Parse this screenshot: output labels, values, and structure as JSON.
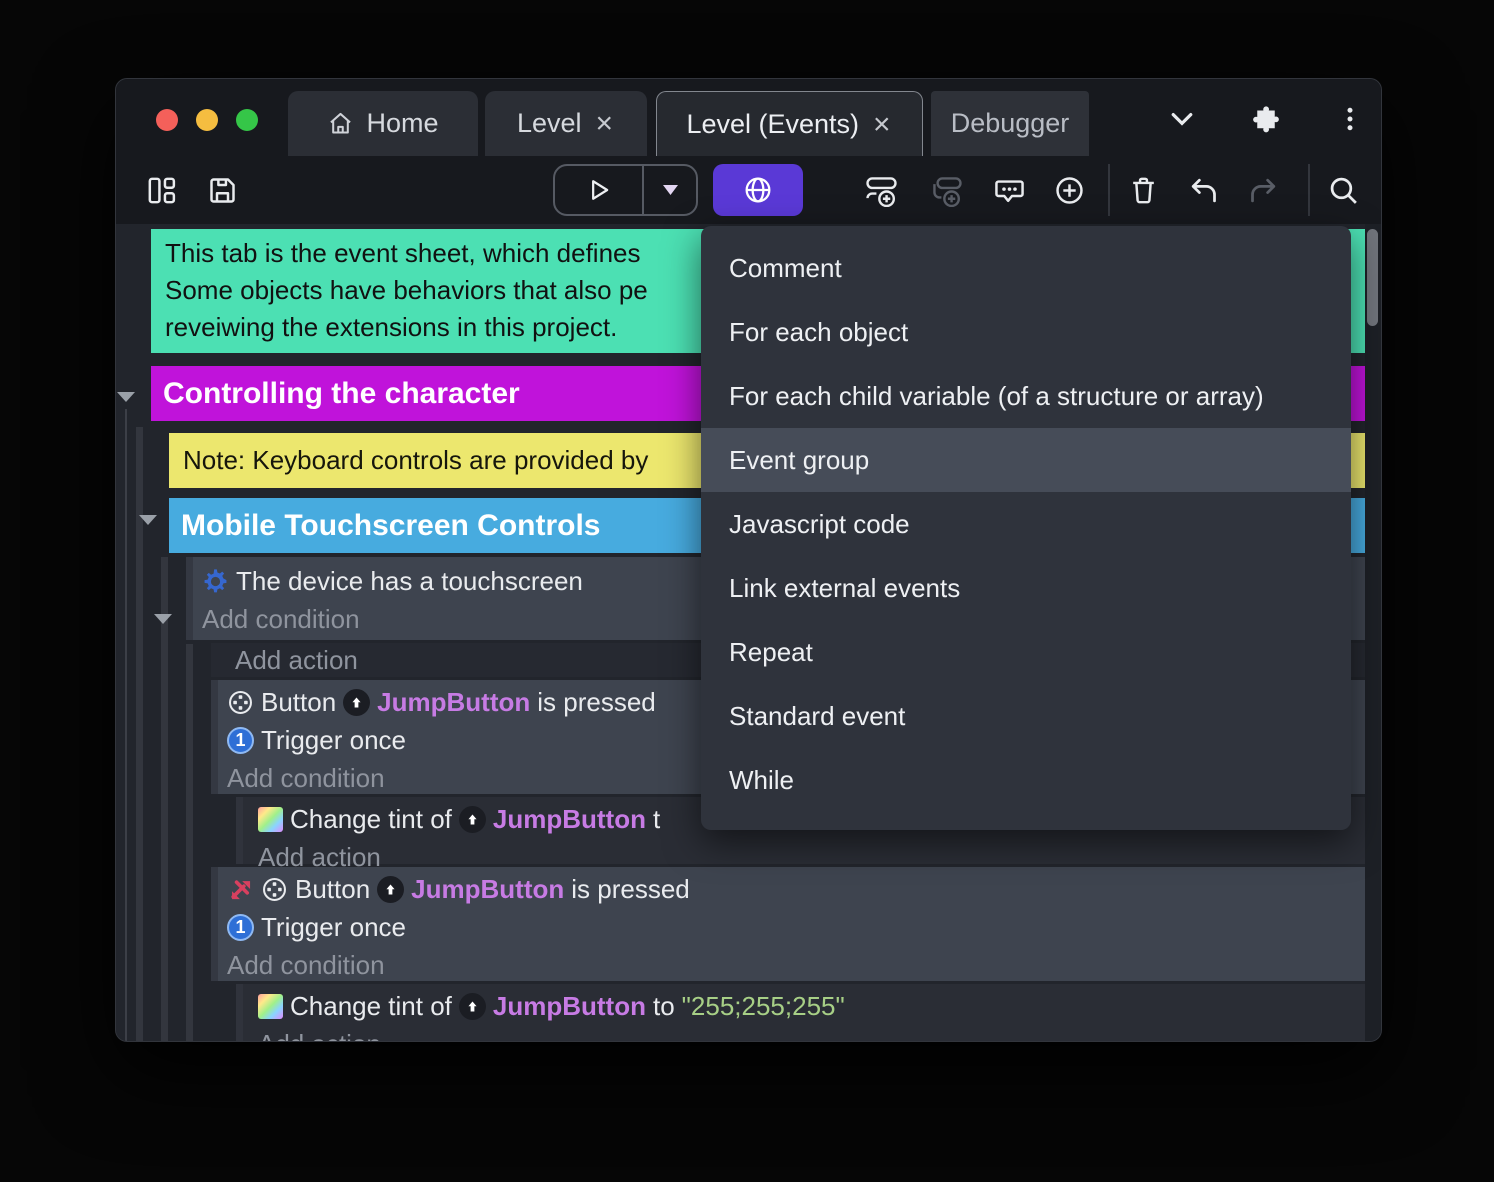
{
  "tab_bar": {
    "home": "Home",
    "level": "Level",
    "level_events": "Level (Events)",
    "debugger": "Debugger",
    "close_glyph": "×"
  },
  "toolbar_icons": [
    "layout-icon",
    "save-icon",
    "play-icon",
    "play-dropdown-icon",
    "globe-icon",
    "add-event-icon",
    "add-subevent-icon",
    "add-comment-icon",
    "add-circle-icon",
    "delete-icon",
    "undo-icon",
    "redo-icon",
    "search-icon"
  ],
  "menu": {
    "items": [
      "Comment",
      "For each object",
      "For each child variable (of a structure or array)",
      "Event group",
      "Javascript code",
      "Link external events",
      "Repeat",
      "Standard event",
      "While"
    ],
    "highlighted": "Event group"
  },
  "sheet": {
    "comment_lines": [
      "This tab is the event sheet, which defines",
      "Some objects have behaviors that also pe",
      "reveiwing the extensions in this project."
    ],
    "group_controlling": "Controlling the character",
    "note": "Note: Keyboard controls are provided by",
    "group_mobile": "Mobile Touchscreen Controls",
    "device_condition": "The device has a touchscreen",
    "add_condition": "Add condition",
    "add_action": "Add action",
    "button_object": "Button",
    "jump_button": "JumpButton",
    "is_pressed": "is pressed",
    "trigger_once": "Trigger once",
    "change_tint_of": "Change tint of",
    "to_word": "to",
    "to_fragment": "t",
    "tint_value": "\"255;255;255\""
  },
  "event_icons": [
    "gear-icon",
    "button-pad-icon",
    "instance-arrow-icon",
    "trigger-once-icon",
    "tint-icon",
    "inverted-condition-icon"
  ],
  "colors": {
    "accent_purple": "#5a39d6",
    "group_magenta": "#c013da",
    "group_blue": "#47abdf",
    "note_yellow": "#ece76e",
    "comment_green": "#4ce0b3",
    "object_name_purple": "#c77be4",
    "string_green": "#a7cf86",
    "event_block": "#3e444f",
    "menu_bg": "#2f333c",
    "menu_highlight": "#464c58",
    "traffic_red": "#f4605a",
    "traffic_yellow": "#f5bd40",
    "traffic_green": "#35c648"
  }
}
